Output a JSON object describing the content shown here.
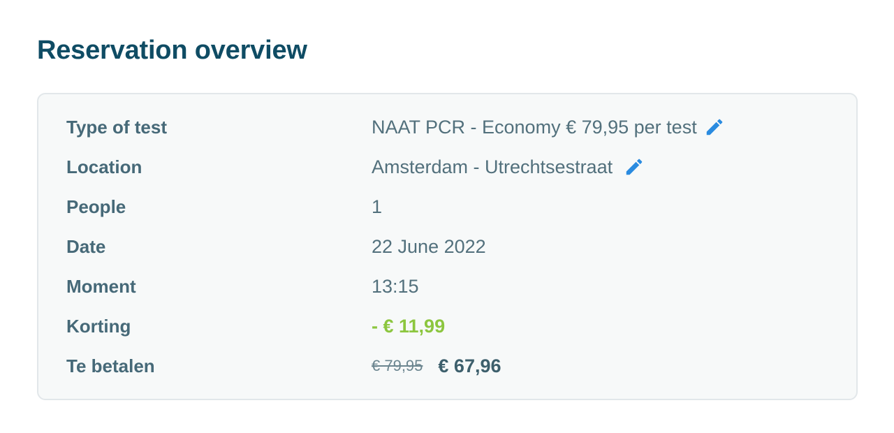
{
  "page": {
    "title": "Reservation overview"
  },
  "reservation": {
    "type_of_test": {
      "label": "Type of test",
      "value": "NAAT PCR - Economy € 79,95 per test",
      "edit_icon": "pencil-icon"
    },
    "location": {
      "label": "Location",
      "value": "Amsterdam - Utrechtsestraat",
      "edit_icon": "pencil-icon"
    },
    "people": {
      "label": "People",
      "value": "1"
    },
    "date": {
      "label": "Date",
      "value": "22 June 2022"
    },
    "moment": {
      "label": "Moment",
      "value": "13:15"
    },
    "korting": {
      "label": "Korting",
      "value": "- € 11,99"
    },
    "te_betalen": {
      "label": "Te betalen",
      "old_price": "€ 79,95",
      "new_price": "€ 67,96"
    }
  },
  "colors": {
    "title": "#0f4c64",
    "label": "#466978",
    "value": "#52707c",
    "discount": "#8cc63f",
    "edit_icon": "#2a8be0",
    "card_background": "#f7f9f9",
    "card_border": "#e2e7ea"
  }
}
